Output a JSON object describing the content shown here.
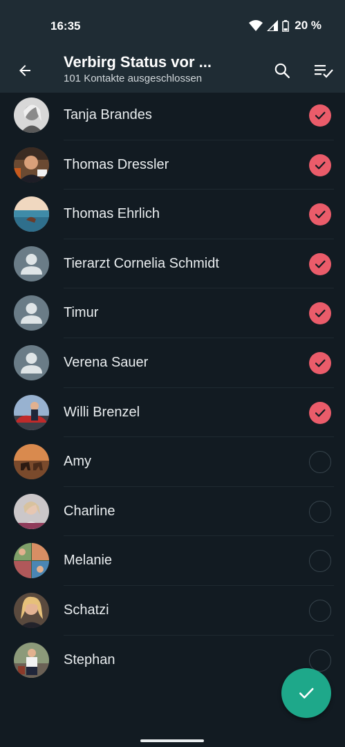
{
  "status_bar": {
    "time": "16:35",
    "battery_text": "20 %"
  },
  "header": {
    "title": "Verbirg Status vor ...",
    "subtitle": "101 Kontakte ausgeschlossen"
  },
  "contacts": [
    {
      "name": "Tanja Brandes",
      "checked": true,
      "avatar": "photo-woman-bw"
    },
    {
      "name": "Thomas Dressler",
      "checked": true,
      "avatar": "photo-man"
    },
    {
      "name": "Thomas Ehrlich",
      "checked": true,
      "avatar": "photo-sea"
    },
    {
      "name": "Tierarzt Cornelia Schmidt",
      "checked": true,
      "avatar": "default-person-icon"
    },
    {
      "name": "Timur",
      "checked": true,
      "avatar": "default-person-icon"
    },
    {
      "name": "Verena Sauer",
      "checked": true,
      "avatar": "default-person-icon"
    },
    {
      "name": "Willi Brenzel",
      "checked": true,
      "avatar": "photo-car"
    },
    {
      "name": "Amy",
      "checked": false,
      "avatar": "photo-horses"
    },
    {
      "name": "Charline",
      "checked": false,
      "avatar": "photo-woman-light"
    },
    {
      "name": "Melanie",
      "checked": false,
      "avatar": "photo-collage"
    },
    {
      "name": "Schatzi",
      "checked": false,
      "avatar": "photo-woman-blonde"
    },
    {
      "name": "Stephan",
      "checked": false,
      "avatar": "photo-man-outdoor"
    }
  ],
  "colors": {
    "background": "#121b22",
    "appbar": "#1f2c34",
    "checked": "#ea5c6a",
    "fab": "#1ea88a"
  },
  "icons": {
    "back": "arrow-left-icon",
    "search": "search-icon",
    "select_all": "select-all-icon",
    "confirm": "check-icon"
  }
}
